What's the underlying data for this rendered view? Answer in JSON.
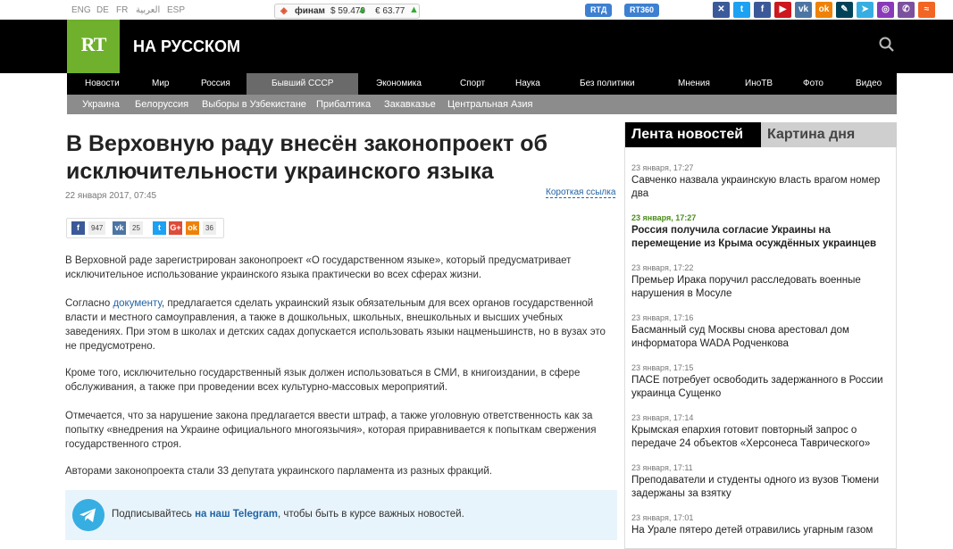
{
  "topbar": {
    "languages": [
      "ENG",
      "DE",
      "FR",
      "العربية",
      "ESP"
    ],
    "finam": {
      "logo": "◈",
      "brand": "финам",
      "usd": "$ 59.479",
      "usd_arrow": "▲",
      "eur": "€ 63.77",
      "eur_arrow": "▲"
    },
    "rtd_label": "RTД",
    "rt360_label": "RT360",
    "social": [
      {
        "icon": "x-icon",
        "glyph": "✕",
        "color": "#3b5a9a"
      },
      {
        "icon": "twitter-icon",
        "glyph": "t",
        "color": "#1da1f2"
      },
      {
        "icon": "facebook-icon",
        "glyph": "f",
        "color": "#3b5998"
      },
      {
        "icon": "youtube-icon",
        "glyph": "▶",
        "color": "#cc181e"
      },
      {
        "icon": "vk-icon",
        "glyph": "vk",
        "color": "#4c75a3"
      },
      {
        "icon": "odnoklassniki-icon",
        "glyph": "ok",
        "color": "#ee8208"
      },
      {
        "icon": "livejournal-icon",
        "glyph": "✎",
        "color": "#004359"
      },
      {
        "icon": "telegram-icon",
        "glyph": "➤",
        "color": "#37aee2"
      },
      {
        "icon": "instagram-icon",
        "glyph": "◎",
        "color": "#8a3ab9"
      },
      {
        "icon": "viber-icon",
        "glyph": "✆",
        "color": "#7b519d"
      },
      {
        "icon": "rss-icon",
        "glyph": "≈",
        "color": "#f26522"
      }
    ]
  },
  "header": {
    "logo": "RT",
    "title": "НА РУССКОМ"
  },
  "nav": [
    "Новости",
    "Мир",
    "Россия",
    "Бывший СССР",
    "Экономика",
    "Спорт",
    "Наука",
    "Без политики",
    "Мнения",
    "ИноТВ",
    "Фото",
    "Видео"
  ],
  "subnav": [
    "Украина",
    "Белоруссия",
    "Выборы в Узбекистане",
    "Прибалтика",
    "Закавказье",
    "Центральная Азия"
  ],
  "article": {
    "title": "В Верховную раду внесён законопроект об исключительности украинского языка",
    "date": "22 января 2017, 07:45",
    "short_link": "Короткая ссылка",
    "share_counts": {
      "fb": "947",
      "vk": "25",
      "ok": "36"
    },
    "paragraphs": [
      "В Верховной раде зарегистрирован законопроект «О государственном языке», который предусматривает исключительное использование украинского языка практически во всех сферах жизни.",
      "Кроме того, исключительно государственный язык должен использоваться в СМИ, в книгоиздании, в сфере обслуживания, а также при проведении всех культурно-массовых мероприятий.",
      "Отмечается, что за нарушение закона предлагается ввести штраф, а также уголовную ответственность как за попытку «внедрения на Украине официального многоязычия», которая приравнивается к попыткам свержения государственного строя.",
      "Авторами законопроекта стали 33 депутата украинского парламента из разных фракций."
    ],
    "p2_before": "Согласно ",
    "p2_link": "документу",
    "p2_after": ", предлагается сделать украинский язык обязательным для всех органов государственной власти и местного самоуправления, а также в дошкольных, школьных, внешкольных и высших учебных заведениях. При этом в школах и детских садах допускается использовать языки нацменьшинств, но в вузах это не предусмотрено.",
    "telegram": {
      "before": "Подписывайтесь ",
      "link": "на наш Telegram",
      "after": ", чтобы быть в курсе важных новостей."
    }
  },
  "sidebar": {
    "tab_feed": "Лента новостей",
    "tab_picture": "Картина дня",
    "news": [
      {
        "time": "23 января, 17:27",
        "headline": "Савченко назвала украинскую власть врагом номер два"
      },
      {
        "time": "23 января, 17:27",
        "headline": "Россия получила согласие Украины на перемещение из Крыма осуждённых украинцев"
      },
      {
        "time": "23 января, 17:22",
        "headline": "Премьер Ирака поручил расследовать военные нарушения в Мосуле"
      },
      {
        "time": "23 января, 17:16",
        "headline": "Басманный суд Москвы снова арестовал дом информатора WADA Родченкова"
      },
      {
        "time": "23 января, 17:15",
        "headline": "ПАСЕ потребует освободить задержанного в России украинца Сущенко"
      },
      {
        "time": "23 января, 17:14",
        "headline": "Крымская епархия готовит повторный запрос о передаче 24 объектов «Херсонеса Таврического»"
      },
      {
        "time": "23 января, 17:11",
        "headline": "Преподаватели и студенты одного из вузов Тюмени задержаны за взятку"
      },
      {
        "time": "23 января, 17:01",
        "headline": "На Урале пятеро детей отравились угарным газом"
      }
    ]
  }
}
